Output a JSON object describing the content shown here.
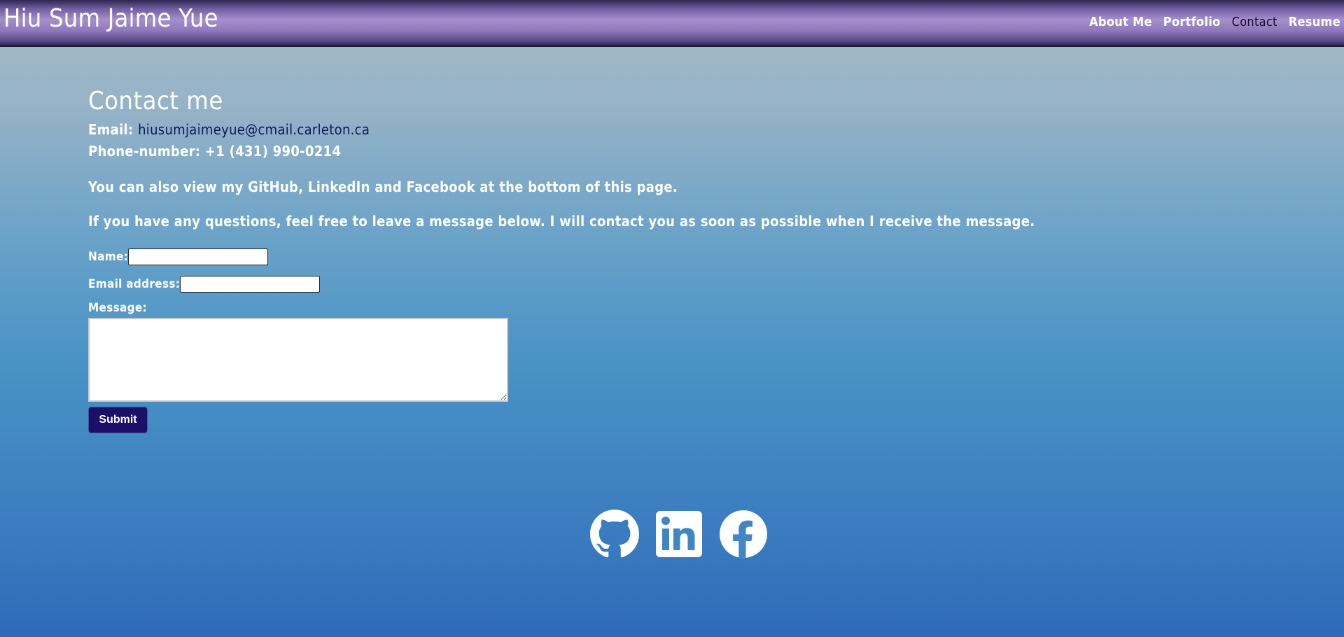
{
  "header": {
    "brand": "Hiu Sum Jaime Yue",
    "nav": [
      "About Me",
      "Portfolio",
      "Contact",
      "Resume"
    ],
    "active_nav": "Contact"
  },
  "contact": {
    "title": "Contact me",
    "email_label": "Email:",
    "email": "hiusumjaimeyue@cmail.carleton.ca",
    "phone_label": "Phone-number:",
    "phone": "+1 (431) 990-0214",
    "social_note": "You can also view my GitHub, LinkedIn and Facebook at the bottom of this page.",
    "message_note": "If you have any questions, feel free to leave a message below. I will contact you as soon as possible when I receive the message."
  },
  "form": {
    "name_label": "Name:",
    "name_value": "",
    "email_label": "Email address:",
    "email_value": "",
    "message_label": "Message:",
    "message_value": "",
    "submit_label": "Submit"
  },
  "social": [
    "github-icon",
    "linkedin-icon",
    "facebook-icon"
  ],
  "colors": {
    "header_purple": "#8e78bb",
    "link_navy": "#0f1660",
    "submit_bg": "#1d0e6a",
    "active_nav": "#160b2a"
  }
}
